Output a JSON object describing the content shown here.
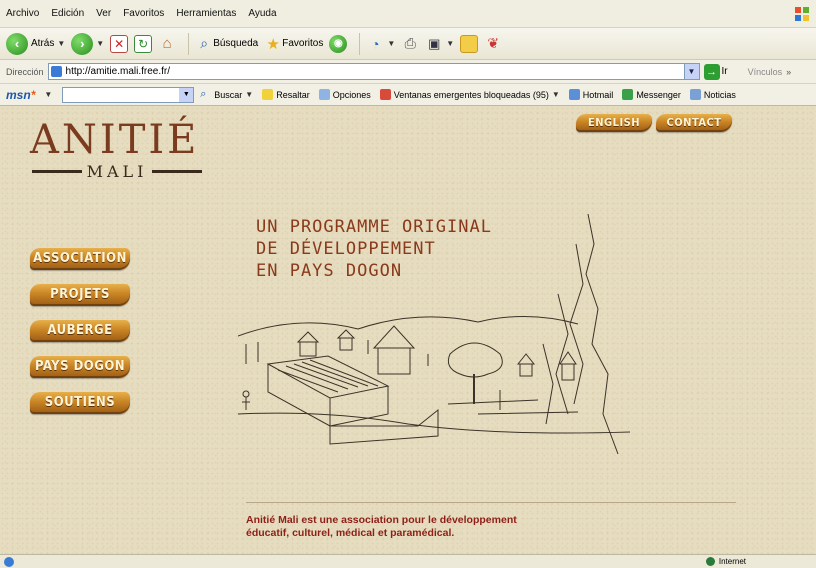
{
  "browser": {
    "menu": [
      "Archivo",
      "Edición",
      "Ver",
      "Favoritos",
      "Herramientas",
      "Ayuda"
    ],
    "toolbar": {
      "back_label": "Atrás",
      "search_label": "Búsqueda",
      "favorites_label": "Favoritos"
    },
    "address": {
      "label": "Dirección",
      "url": "http://amitie.mali.free.fr/",
      "go_label": "Ir",
      "links_label": "Vínculos"
    },
    "msn": {
      "search_label": "Buscar",
      "highlight_label": "Resaltar",
      "options_label": "Opciones",
      "popups_label": "Ventanas emergentes bloqueadas (95)",
      "hotmail_label": "Hotmail",
      "messenger_label": "Messenger",
      "news_label": "Noticias"
    },
    "status": {
      "zone_label": "Internet"
    }
  },
  "site": {
    "logo_word": "ANITIÉ",
    "logo_sub": "MALI",
    "top_nav": [
      "ENGLISH",
      "CONTACT"
    ],
    "side_nav": [
      "ASSOCIATION",
      "PROJETS",
      "AUBERGE",
      "PAYS DOGON",
      "SOUTIENS"
    ],
    "headline": [
      "UN PROGRAMME ORIGINAL",
      "DE DÉVELOPPEMENT",
      "EN PAYS DOGON"
    ],
    "tagline": [
      "Anitié Mali est une association pour le développement",
      "éducatif, culturel, médical et paramédical."
    ]
  },
  "colors": {
    "accent_brown": "#7a3b1f",
    "headline_rust": "#8a3a1a",
    "tagline_red": "#8e1f17",
    "page_beige": "#e6dcc0",
    "wood": "#c98424"
  }
}
